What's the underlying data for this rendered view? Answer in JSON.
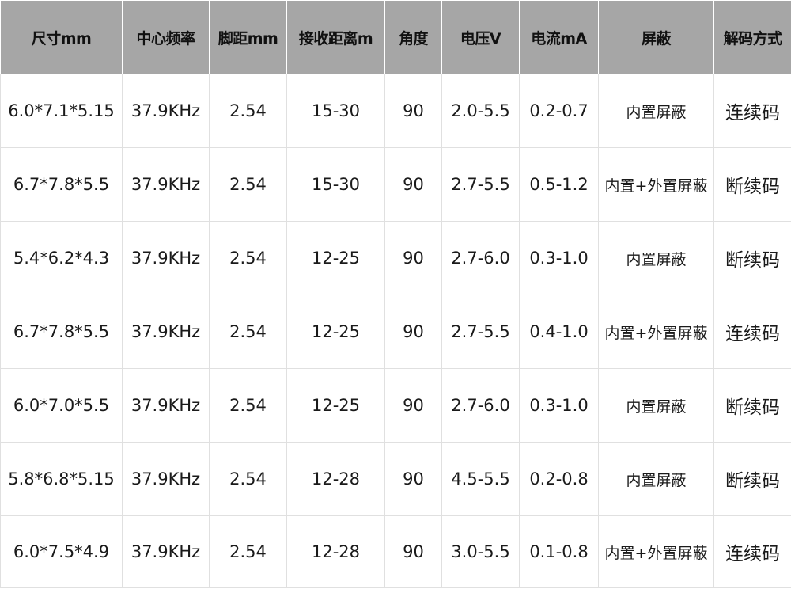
{
  "table": {
    "headers": [
      "尺寸mm",
      "中心频率",
      "脚距mm",
      "接收距离m",
      "角度",
      "电压V",
      "电流mA",
      "屏蔽",
      "解码方式"
    ],
    "rows": [
      [
        "6.0*7.1*5.15",
        "37.9KHz",
        "2.54",
        "15-30",
        "90",
        "2.0-5.5",
        "0.2-0.7",
        "内置屏蔽",
        "连续码"
      ],
      [
        "6.7*7.8*5.5",
        "37.9KHz",
        "2.54",
        "15-30",
        "90",
        "2.7-5.5",
        "0.5-1.2",
        "内置+外置屏蔽",
        "断续码"
      ],
      [
        "5.4*6.2*4.3",
        "37.9KHz",
        "2.54",
        "12-25",
        "90",
        "2.7-6.0",
        "0.3-1.0",
        "内置屏蔽",
        "断续码"
      ],
      [
        "6.7*7.8*5.5",
        "37.9KHz",
        "2.54",
        "12-25",
        "90",
        "2.7-5.5",
        "0.4-1.0",
        "内置+外置屏蔽",
        "连续码"
      ],
      [
        "6.0*7.0*5.5",
        "37.9KHz",
        "2.54",
        "12-25",
        "90",
        "2.7-6.0",
        "0.3-1.0",
        "内置屏蔽",
        "断续码"
      ],
      [
        "5.8*6.8*5.15",
        "37.9KHz",
        "2.54",
        "12-28",
        "90",
        "4.5-5.5",
        "0.2-0.8",
        "内置屏蔽",
        "断续码"
      ],
      [
        "6.0*7.5*4.9",
        "37.9KHz",
        "2.54",
        "12-28",
        "90",
        "3.0-5.5",
        "0.1-0.8",
        "内置+外置屏蔽",
        "连续码"
      ]
    ]
  },
  "colors": {
    "header_bg": "#a6a6a6",
    "grid": "#e0e0e0",
    "text": "#1a1a1a"
  }
}
